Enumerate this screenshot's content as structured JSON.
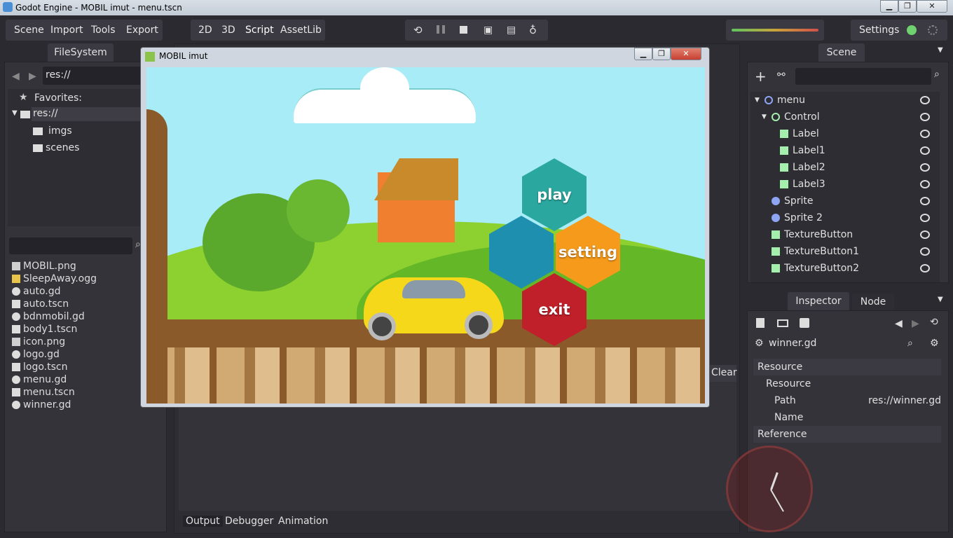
{
  "window": {
    "title": "Godot Engine - MOBIL imut - menu.tscn"
  },
  "menubar": {
    "left_menu": [
      "Scene",
      "Import",
      "Tools",
      "Export"
    ],
    "modes": [
      "2D",
      "3D",
      "Script",
      "AssetLib"
    ],
    "settings_label": "Settings"
  },
  "filesystem": {
    "tab_label": "FileSystem",
    "path": "res://",
    "favorites_label": "Favorites:",
    "tree": [
      "res://",
      "imgs",
      "scenes"
    ],
    "files": [
      {
        "name": "MOBIL.png",
        "icon": "image-icon"
      },
      {
        "name": "SleepAway.ogg",
        "icon": "audio-icon"
      },
      {
        "name": "auto.gd",
        "icon": "gear-icon"
      },
      {
        "name": "auto.tscn",
        "icon": "scene-icon"
      },
      {
        "name": "bdnmobil.gd",
        "icon": "gear-icon"
      },
      {
        "name": "body1.tscn",
        "icon": "scene-icon"
      },
      {
        "name": "icon.png",
        "icon": "image-icon"
      },
      {
        "name": "logo.gd",
        "icon": "gear-icon"
      },
      {
        "name": "logo.tscn",
        "icon": "scene-icon"
      },
      {
        "name": "menu.gd",
        "icon": "gear-icon"
      },
      {
        "name": "menu.tscn",
        "icon": "scene-icon"
      },
      {
        "name": "winner.gd",
        "icon": "gear-icon"
      }
    ]
  },
  "game_window": {
    "title": "MOBIL imut",
    "buttons": {
      "play": "play",
      "setting": "setting",
      "exit": "exit"
    }
  },
  "scene": {
    "tab_label": "Scene",
    "nodes": [
      {
        "name": "menu",
        "type": "node"
      },
      {
        "name": "Control",
        "type": "control"
      },
      {
        "name": "Label",
        "type": "label"
      },
      {
        "name": "Label1",
        "type": "label"
      },
      {
        "name": "Label2",
        "type": "label"
      },
      {
        "name": "Label3",
        "type": "label"
      },
      {
        "name": "Sprite",
        "type": "sprite"
      },
      {
        "name": "Sprite 2",
        "type": "sprite"
      },
      {
        "name": "TextureButton",
        "type": "texturebutton"
      },
      {
        "name": "TextureButton1",
        "type": "texturebutton"
      },
      {
        "name": "TextureButton2",
        "type": "texturebutton"
      }
    ]
  },
  "inspector": {
    "tabs": [
      "Inspector",
      "Node"
    ],
    "resource_name": "winner.gd",
    "sections": {
      "resource_header": "Resource",
      "resource_sub": "Resource",
      "path_label": "Path",
      "path_value": "res://winner.gd",
      "name_label": "Name",
      "reference_header": "Reference"
    }
  },
  "bottom": {
    "tabs": [
      "Output",
      "Debugger",
      "Animation"
    ],
    "clear_label": "Clear"
  },
  "colors": {
    "accent": "#6fd16f",
    "panel": "#34333a",
    "bg": "#2b2a30"
  }
}
